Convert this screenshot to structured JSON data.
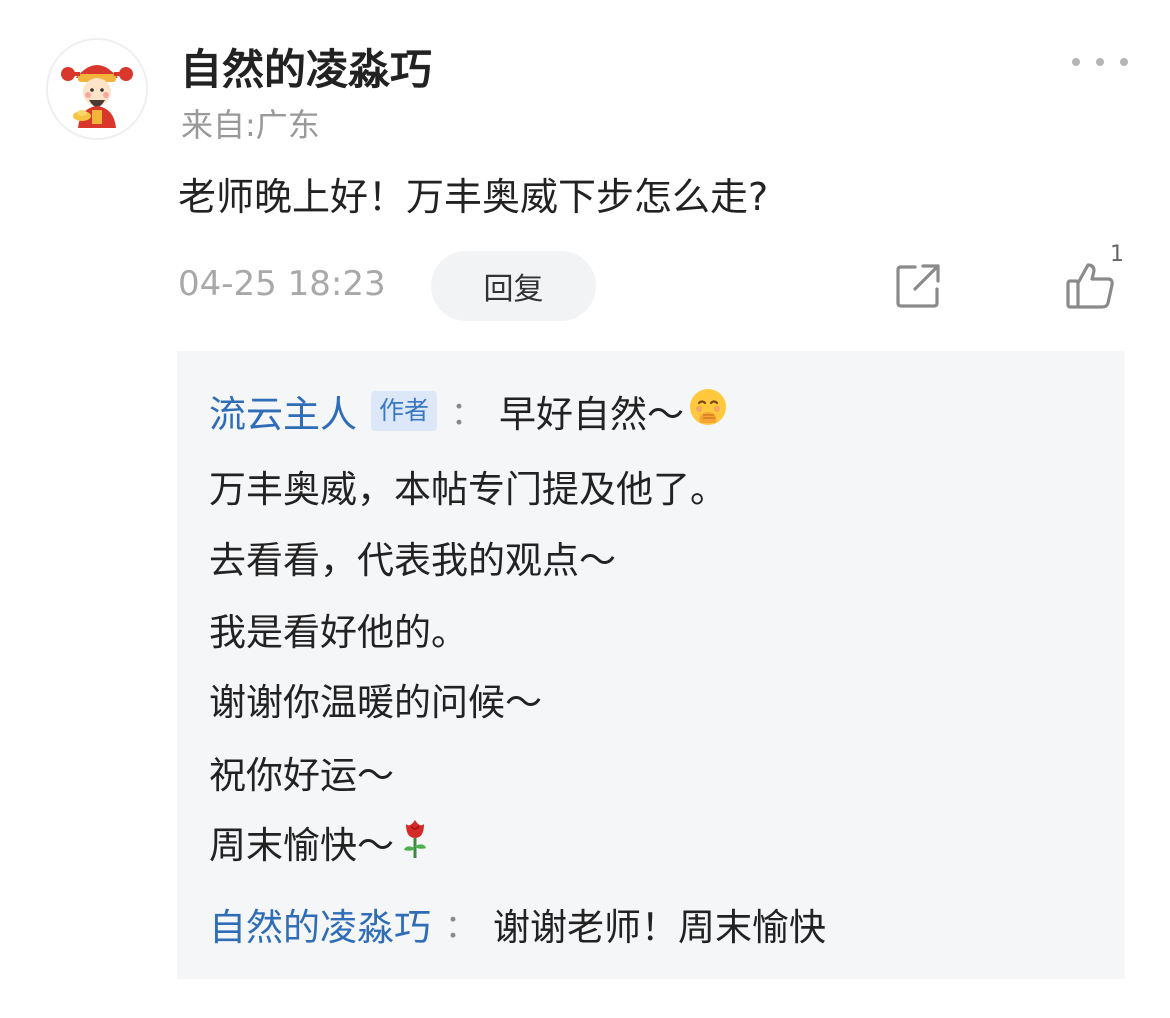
{
  "comment": {
    "username": "自然的凌淼巧",
    "location": "来自:广东",
    "text": "老师晚上好！万丰奥威下步怎么走?",
    "timestamp": "04-25 18:23",
    "reply_label": "回复",
    "like_count": "1",
    "avatar_icon": "god-of-wealth-avatar",
    "more_icon": "more-dots-icon",
    "share_icon": "share-icon",
    "like_icon": "thumbs-up-icon"
  },
  "replies": {
    "first": {
      "author": "流云主人",
      "author_tag": "作者",
      "colon": "：",
      "lines": [
        "早好自然～",
        "万丰奥威，本帖专门提及他了。",
        "去看看，代表我的观点～",
        "我是看好他的。",
        "谢谢你温暖的问候～",
        "祝你好运～",
        "周末愉快～"
      ],
      "emoji_after_first": "smiling-face-with-hand-over-mouth",
      "emoji_after_last": "rose"
    },
    "second": {
      "author": "自然的凌淼巧",
      "colon": "：",
      "text": "谢谢老师！周末愉快"
    }
  },
  "colors": {
    "link_blue": "#2f6db7",
    "tag_bg": "#dce8f7",
    "reply_bg": "#f5f6f8",
    "muted": "#999999"
  }
}
